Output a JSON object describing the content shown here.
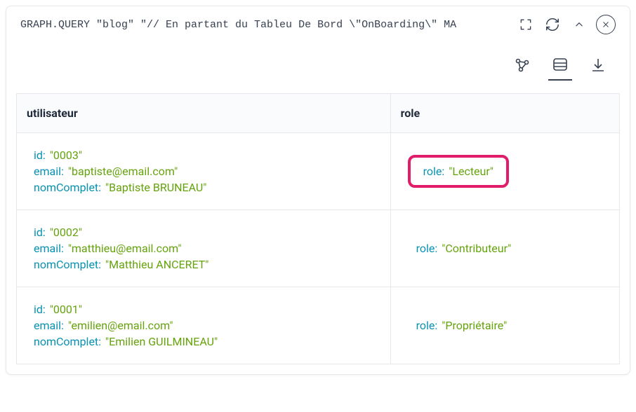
{
  "query": "GRAPH.QUERY \"blog\" \"// En partant du Tableu De Bord \\\"OnBoarding\\\" MA",
  "columns": {
    "user": "utilisateur",
    "role": "role"
  },
  "rows": [
    {
      "user": {
        "id_key": "id:",
        "id_val": "\"0003\"",
        "email_key": "email:",
        "email_val": "\"baptiste@email.com\"",
        "name_key": "nomComplet:",
        "name_val": "\"Baptiste BRUNEAU\""
      },
      "role": {
        "key": "role:",
        "val": "\"Lecteur\""
      },
      "highlight": true
    },
    {
      "user": {
        "id_key": "id:",
        "id_val": "\"0002\"",
        "email_key": "email:",
        "email_val": "\"matthieu@email.com\"",
        "name_key": "nomComplet:",
        "name_val": "\"Matthieu ANCERET\""
      },
      "role": {
        "key": "role:",
        "val": "\"Contributeur\""
      },
      "highlight": false
    },
    {
      "user": {
        "id_key": "id:",
        "id_val": "\"0001\"",
        "email_key": "email:",
        "email_val": "\"emilien@email.com\"",
        "name_key": "nomComplet:",
        "name_val": "\"Emilien GUILMINEAU\""
      },
      "role": {
        "key": "role:",
        "val": "\"Propriétaire\""
      },
      "highlight": false
    }
  ]
}
